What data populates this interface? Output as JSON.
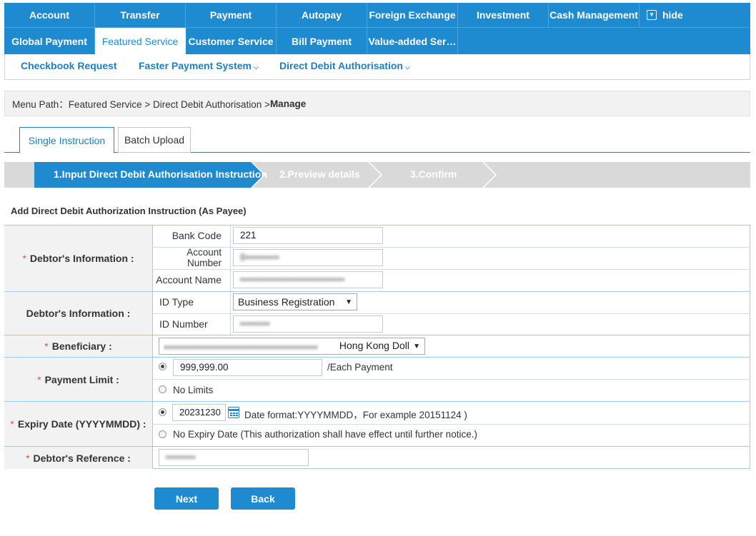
{
  "nav": {
    "row1": [
      "Account",
      "Transfer",
      "Payment",
      "Autopay",
      "Foreign Exchange",
      "Investment",
      "Cash Management"
    ],
    "hide_label": "hide",
    "hide_icon": "collapse-icon",
    "row2": [
      "Global Payment",
      "Featured Service",
      "Customer Service",
      "Bill Payment",
      "Value-added Ser…"
    ],
    "active": "Featured Service"
  },
  "subnav": {
    "items": [
      "Checkbook Request",
      "Faster Payment System",
      "Direct Debit Authorisation"
    ],
    "chevron": "⌄"
  },
  "breadcrumb": {
    "prefix": "Menu Path：Featured Service > Direct Debit Authorisation > ",
    "current": "Manage"
  },
  "tabs": [
    "Single Instruction",
    "Batch Upload"
  ],
  "steps": [
    "1.Input Direct Debit Authorisation Instruction",
    "2.Preview details",
    "3.Confirm"
  ],
  "form": {
    "title": "Add Direct Debit Authorization Instruction (As Payee)",
    "required_mark": "*",
    "debtor_info_label": "Debtor's Information :",
    "bank_code_label": "Bank Code",
    "bank_code_value": "221",
    "account_number_label": "Account Number",
    "account_number_value": "8•••••••••",
    "account_name_label": "Account Name",
    "account_name_value": "••••••••••••••••••••••••••••",
    "debtor_info2_label": "Debtor's Information :",
    "id_type_label": "ID Type",
    "id_type_value": "Business Registration",
    "id_number_label": "ID Number",
    "id_number_value": "••••••••",
    "beneficiary_label": "Beneficiary :",
    "beneficiary_value": "••••••••••••••••••••••••••••••••••••••••",
    "beneficiary_currency": "Hong Kong Dollar",
    "payment_limit_label": "Payment Limit :",
    "payment_limit_value": "999,999.00",
    "each_payment": "/Each Payment",
    "no_limits": "No Limits",
    "expiry_label": "Expiry Date (YYYYMMDD) :",
    "expiry_value": "20231230",
    "date_format_hint": "Date format:YYYYMMDD，For example 20151124 )",
    "no_expiry": "No Expiry Date (This authorization shall have effect until further notice.)",
    "reference_label": "Debtor's Reference :",
    "reference_value": "••••••••"
  },
  "buttons": {
    "next": "Next",
    "back": "Back"
  },
  "colors": {
    "brand": "#1e8bd1",
    "required": "#d9534f"
  }
}
